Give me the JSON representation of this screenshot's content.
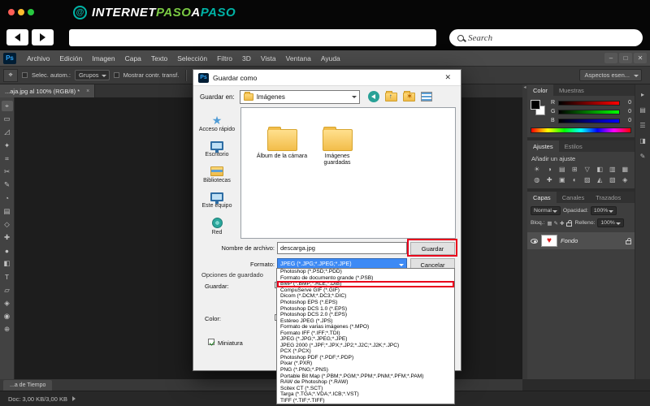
{
  "brand": {
    "icon_glyph": "@",
    "segments": [
      "INTERNET",
      "PASO",
      "A",
      "PASO"
    ],
    "colors": {
      "green": "#7ac943",
      "teal": "#00b3a6"
    }
  },
  "nav": {
    "search_placeholder": "Search"
  },
  "menubar": {
    "logo": "Ps",
    "items": [
      "Archivo",
      "Edición",
      "Imagen",
      "Capa",
      "Texto",
      "Selección",
      "Filtro",
      "3D",
      "Vista",
      "Ventana",
      "Ayuda"
    ],
    "controls": {
      "minimize": "–",
      "maximize": "□",
      "close": "✕"
    }
  },
  "options_bar": {
    "auto_select_label": "Selec. autom.:",
    "auto_select_target": "Grupos",
    "show_transform_label": "Mostrar contr. transf.",
    "workspace_label": "Aspectos esen..."
  },
  "document": {
    "tab_title": "...aja.jpg al 100% (RGB/8) *",
    "tab_close": "×"
  },
  "toolbar_tools": [
    "⌖",
    "▭",
    "◿",
    "✦",
    "⌗",
    "✂",
    "✎",
    "◔",
    "▤",
    "◇",
    "✚",
    "●",
    "◧",
    "T",
    "▱",
    "◈",
    "◉",
    "⊕"
  ],
  "dialog": {
    "title": "Guardar como",
    "logo": "Ps",
    "close_glyph": "✕",
    "save_in_label": "Guardar en:",
    "save_in_value": "Imágenes",
    "sidebar_items": [
      "Acceso rápido",
      "Escritorio",
      "Bibliotecas",
      "Este equipo",
      "Red"
    ],
    "folders": [
      "Álbum de la cámara",
      "Imágenes guardadas"
    ],
    "filename_label": "Nombre de archivo:",
    "filename_value": "descarga.jpg",
    "format_label": "Formato:",
    "format_value": "JPEG (*.JPG;*.JPEG;*.JPE)",
    "save_button": "Guardar",
    "cancel_button": "Cancelar",
    "options_title": "Opciones de guardado",
    "options_save_label": "Guardar:",
    "options_color_label": "Color:",
    "thumbnail_label": "Miniatura",
    "annotation_color": "#e8001c",
    "annotated_format_index": 2,
    "format_options": [
      "Photoshop (*.PSD;*.PDD)",
      "Formato de documento grande (*.PSB)",
      "BMP (*.BMP;*.RLE;*.DIB)",
      "CompuServe GIF (*.GIF)",
      "Dicom (*.DCM;*.DC3;*.DIC)",
      "Photoshop EPS (*.EPS)",
      "Photoshop DCS 1.0 (*.EPS)",
      "Photoshop DCS 2.0 (*.EPS)",
      "Estéreo JPEG (*.JPS)",
      "Formato de varias imágenes (*.MPO)",
      "Formato IFF (*.IFF;*.TDI)",
      "JPEG (*.JPG;*.JPEG;*.JPE)",
      "JPEG 2000 (*.JPF;*.JPX;*.JP2;*.J2C;*.J2K;*.JPC)",
      "PCX (*.PCX)",
      "Photoshop PDF (*.PDF;*.PDP)",
      "Pixar (*.PXR)",
      "PNG (*.PNG;*.PNS)",
      "Portable Bit Map (*.PBM;*.PGM;*.PPM;*.PNM;*.PFM;*.PAM)",
      "RAW de Photoshop (*.RAW)",
      "Scitex CT (*.SCT)",
      "Targa (*.TGA;*.VDA;*.ICB;*.VST)",
      "TIFF (*.TIF;*.TIFF)"
    ]
  },
  "panels": {
    "color": {
      "tabs": [
        "Color",
        "Muestras"
      ],
      "channels": [
        {
          "label": "R",
          "value": "0"
        },
        {
          "label": "G",
          "value": "0"
        },
        {
          "label": "B",
          "value": "0"
        }
      ]
    },
    "adjustments": {
      "tabs": [
        "Ajustes",
        "Estilos"
      ],
      "title": "Añadir un ajuste",
      "icons": [
        "☀",
        "◑",
        "▤",
        "⊞",
        "▽",
        "◧",
        "▥",
        "▦",
        "◍",
        "✚",
        "▣",
        "◐",
        "▨",
        "◭",
        "▧",
        "◈"
      ]
    },
    "layers": {
      "tabs": [
        "Capas",
        "Canales",
        "Trazados"
      ],
      "blend_mode": "Normal",
      "opacity_label": "Opacidad:",
      "opacity_value": "100%",
      "lock_label": "Bloq.:",
      "lock_glyphs": [
        "▦",
        "✎",
        "✚"
      ],
      "fill_label": "Relleno:",
      "fill_value": "100%",
      "layer_name": "Fondo",
      "heart_glyph": "♥"
    },
    "rail_icons": [
      "▸",
      "▤",
      "☰",
      "◨",
      "✎"
    ]
  },
  "statusbar": {
    "doc_info": "Doc: 3,00 KB/3,00 KB",
    "timeline_tab": "...a de Tiempo"
  }
}
